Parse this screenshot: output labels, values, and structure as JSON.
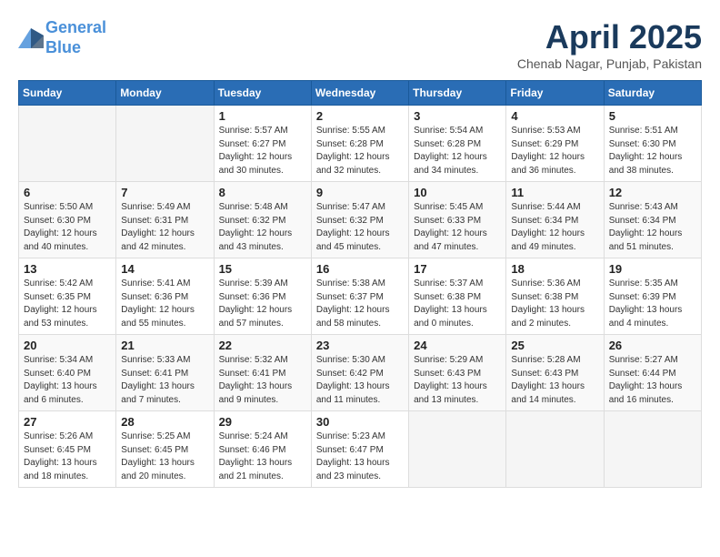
{
  "logo": {
    "line1": "General",
    "line2": "Blue"
  },
  "title": "April 2025",
  "subtitle": "Chenab Nagar, Punjab, Pakistan",
  "days_of_week": [
    "Sunday",
    "Monday",
    "Tuesday",
    "Wednesday",
    "Thursday",
    "Friday",
    "Saturday"
  ],
  "weeks": [
    [
      {
        "day": "",
        "sunrise": "",
        "sunset": "",
        "daylight": ""
      },
      {
        "day": "",
        "sunrise": "",
        "sunset": "",
        "daylight": ""
      },
      {
        "day": "1",
        "sunrise": "Sunrise: 5:57 AM",
        "sunset": "Sunset: 6:27 PM",
        "daylight": "Daylight: 12 hours and 30 minutes."
      },
      {
        "day": "2",
        "sunrise": "Sunrise: 5:55 AM",
        "sunset": "Sunset: 6:28 PM",
        "daylight": "Daylight: 12 hours and 32 minutes."
      },
      {
        "day": "3",
        "sunrise": "Sunrise: 5:54 AM",
        "sunset": "Sunset: 6:28 PM",
        "daylight": "Daylight: 12 hours and 34 minutes."
      },
      {
        "day": "4",
        "sunrise": "Sunrise: 5:53 AM",
        "sunset": "Sunset: 6:29 PM",
        "daylight": "Daylight: 12 hours and 36 minutes."
      },
      {
        "day": "5",
        "sunrise": "Sunrise: 5:51 AM",
        "sunset": "Sunset: 6:30 PM",
        "daylight": "Daylight: 12 hours and 38 minutes."
      }
    ],
    [
      {
        "day": "6",
        "sunrise": "Sunrise: 5:50 AM",
        "sunset": "Sunset: 6:30 PM",
        "daylight": "Daylight: 12 hours and 40 minutes."
      },
      {
        "day": "7",
        "sunrise": "Sunrise: 5:49 AM",
        "sunset": "Sunset: 6:31 PM",
        "daylight": "Daylight: 12 hours and 42 minutes."
      },
      {
        "day": "8",
        "sunrise": "Sunrise: 5:48 AM",
        "sunset": "Sunset: 6:32 PM",
        "daylight": "Daylight: 12 hours and 43 minutes."
      },
      {
        "day": "9",
        "sunrise": "Sunrise: 5:47 AM",
        "sunset": "Sunset: 6:32 PM",
        "daylight": "Daylight: 12 hours and 45 minutes."
      },
      {
        "day": "10",
        "sunrise": "Sunrise: 5:45 AM",
        "sunset": "Sunset: 6:33 PM",
        "daylight": "Daylight: 12 hours and 47 minutes."
      },
      {
        "day": "11",
        "sunrise": "Sunrise: 5:44 AM",
        "sunset": "Sunset: 6:34 PM",
        "daylight": "Daylight: 12 hours and 49 minutes."
      },
      {
        "day": "12",
        "sunrise": "Sunrise: 5:43 AM",
        "sunset": "Sunset: 6:34 PM",
        "daylight": "Daylight: 12 hours and 51 minutes."
      }
    ],
    [
      {
        "day": "13",
        "sunrise": "Sunrise: 5:42 AM",
        "sunset": "Sunset: 6:35 PM",
        "daylight": "Daylight: 12 hours and 53 minutes."
      },
      {
        "day": "14",
        "sunrise": "Sunrise: 5:41 AM",
        "sunset": "Sunset: 6:36 PM",
        "daylight": "Daylight: 12 hours and 55 minutes."
      },
      {
        "day": "15",
        "sunrise": "Sunrise: 5:39 AM",
        "sunset": "Sunset: 6:36 PM",
        "daylight": "Daylight: 12 hours and 57 minutes."
      },
      {
        "day": "16",
        "sunrise": "Sunrise: 5:38 AM",
        "sunset": "Sunset: 6:37 PM",
        "daylight": "Daylight: 12 hours and 58 minutes."
      },
      {
        "day": "17",
        "sunrise": "Sunrise: 5:37 AM",
        "sunset": "Sunset: 6:38 PM",
        "daylight": "Daylight: 13 hours and 0 minutes."
      },
      {
        "day": "18",
        "sunrise": "Sunrise: 5:36 AM",
        "sunset": "Sunset: 6:38 PM",
        "daylight": "Daylight: 13 hours and 2 minutes."
      },
      {
        "day": "19",
        "sunrise": "Sunrise: 5:35 AM",
        "sunset": "Sunset: 6:39 PM",
        "daylight": "Daylight: 13 hours and 4 minutes."
      }
    ],
    [
      {
        "day": "20",
        "sunrise": "Sunrise: 5:34 AM",
        "sunset": "Sunset: 6:40 PM",
        "daylight": "Daylight: 13 hours and 6 minutes."
      },
      {
        "day": "21",
        "sunrise": "Sunrise: 5:33 AM",
        "sunset": "Sunset: 6:41 PM",
        "daylight": "Daylight: 13 hours and 7 minutes."
      },
      {
        "day": "22",
        "sunrise": "Sunrise: 5:32 AM",
        "sunset": "Sunset: 6:41 PM",
        "daylight": "Daylight: 13 hours and 9 minutes."
      },
      {
        "day": "23",
        "sunrise": "Sunrise: 5:30 AM",
        "sunset": "Sunset: 6:42 PM",
        "daylight": "Daylight: 13 hours and 11 minutes."
      },
      {
        "day": "24",
        "sunrise": "Sunrise: 5:29 AM",
        "sunset": "Sunset: 6:43 PM",
        "daylight": "Daylight: 13 hours and 13 minutes."
      },
      {
        "day": "25",
        "sunrise": "Sunrise: 5:28 AM",
        "sunset": "Sunset: 6:43 PM",
        "daylight": "Daylight: 13 hours and 14 minutes."
      },
      {
        "day": "26",
        "sunrise": "Sunrise: 5:27 AM",
        "sunset": "Sunset: 6:44 PM",
        "daylight": "Daylight: 13 hours and 16 minutes."
      }
    ],
    [
      {
        "day": "27",
        "sunrise": "Sunrise: 5:26 AM",
        "sunset": "Sunset: 6:45 PM",
        "daylight": "Daylight: 13 hours and 18 minutes."
      },
      {
        "day": "28",
        "sunrise": "Sunrise: 5:25 AM",
        "sunset": "Sunset: 6:45 PM",
        "daylight": "Daylight: 13 hours and 20 minutes."
      },
      {
        "day": "29",
        "sunrise": "Sunrise: 5:24 AM",
        "sunset": "Sunset: 6:46 PM",
        "daylight": "Daylight: 13 hours and 21 minutes."
      },
      {
        "day": "30",
        "sunrise": "Sunrise: 5:23 AM",
        "sunset": "Sunset: 6:47 PM",
        "daylight": "Daylight: 13 hours and 23 minutes."
      },
      {
        "day": "",
        "sunrise": "",
        "sunset": "",
        "daylight": ""
      },
      {
        "day": "",
        "sunrise": "",
        "sunset": "",
        "daylight": ""
      },
      {
        "day": "",
        "sunrise": "",
        "sunset": "",
        "daylight": ""
      }
    ]
  ]
}
